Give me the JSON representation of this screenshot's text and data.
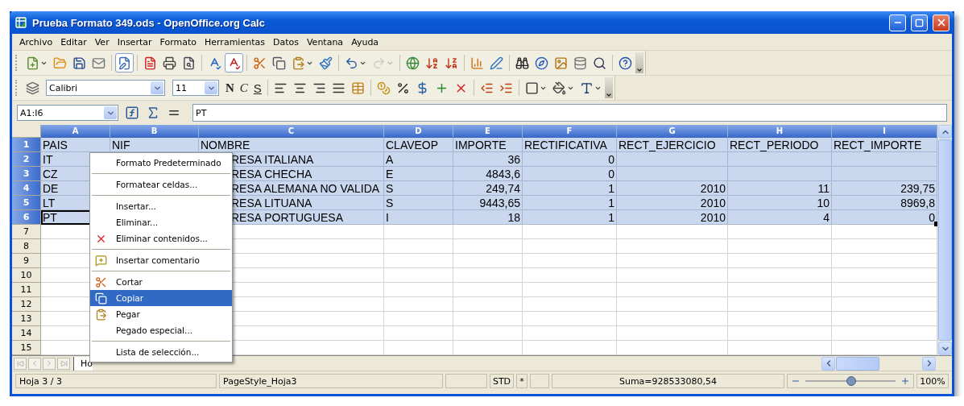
{
  "window": {
    "title": "Prueba Formato 349.ods - OpenOffice.org Calc"
  },
  "menu": [
    "Archivo",
    "Editar",
    "Ver",
    "Insertar",
    "Formato",
    "Herramientas",
    "Datos",
    "Ventana",
    "Ayuda"
  ],
  "toolbar_standard": [
    {
      "kind": "new",
      "dropdown": true
    },
    {
      "kind": "open"
    },
    {
      "kind": "save"
    },
    {
      "kind": "email"
    },
    {
      "kind": "separator"
    },
    {
      "kind": "edit",
      "pressed": true
    },
    {
      "kind": "separator"
    },
    {
      "kind": "pdf"
    },
    {
      "kind": "print"
    },
    {
      "kind": "preview"
    },
    {
      "kind": "separator"
    },
    {
      "kind": "spellcheck"
    },
    {
      "kind": "autospell",
      "pressed": true
    },
    {
      "kind": "separator"
    },
    {
      "kind": "cut"
    },
    {
      "kind": "copy"
    },
    {
      "kind": "paste",
      "dropdown": true
    },
    {
      "kind": "brush"
    },
    {
      "kind": "separator"
    },
    {
      "kind": "undo",
      "dropdown": true
    },
    {
      "kind": "redo",
      "dropdown": true,
      "disabled": true
    },
    {
      "kind": "separator"
    },
    {
      "kind": "navigator"
    },
    {
      "kind": "sort_asc"
    },
    {
      "kind": "sort_desc"
    },
    {
      "kind": "separator"
    },
    {
      "kind": "chart"
    },
    {
      "kind": "draw"
    },
    {
      "kind": "separator"
    },
    {
      "kind": "find"
    },
    {
      "kind": "compass"
    },
    {
      "kind": "gallery"
    },
    {
      "kind": "database"
    },
    {
      "kind": "zoom"
    },
    {
      "kind": "separator"
    },
    {
      "kind": "help"
    }
  ],
  "toolbar_format": [
    {
      "kind": "styles"
    },
    {
      "kind": "font_name",
      "value": "Calibri"
    },
    {
      "kind": "font_size",
      "value": "11"
    },
    {
      "kind": "bold",
      "label": "N"
    },
    {
      "kind": "italic",
      "label": "C"
    },
    {
      "kind": "underline",
      "label": "S"
    },
    {
      "kind": "separator"
    },
    {
      "kind": "align_left"
    },
    {
      "kind": "align_center"
    },
    {
      "kind": "align_right"
    },
    {
      "kind": "justify"
    },
    {
      "kind": "merge"
    },
    {
      "kind": "separator"
    },
    {
      "kind": "currency"
    },
    {
      "kind": "percent"
    },
    {
      "kind": "standard_format"
    },
    {
      "kind": "add_decimal"
    },
    {
      "kind": "delete_decimal"
    },
    {
      "kind": "separator"
    },
    {
      "kind": "indent_decrease"
    },
    {
      "kind": "indent_increase"
    },
    {
      "kind": "separator"
    },
    {
      "kind": "borders",
      "dropdown": true
    },
    {
      "kind": "background",
      "dropdown": true
    },
    {
      "kind": "font_color",
      "dropdown": true
    }
  ],
  "formula_bar": {
    "cell_reference": "A1:I6",
    "content": "PT"
  },
  "sheet": {
    "columns": [
      {
        "label": "A",
        "selected": true
      },
      {
        "label": "B",
        "selected": true
      },
      {
        "label": "C",
        "selected": true
      },
      {
        "label": "D",
        "selected": true
      },
      {
        "label": "E",
        "selected": true
      },
      {
        "label": "F",
        "selected": true
      },
      {
        "label": "G",
        "selected": true
      },
      {
        "label": "H",
        "selected": true
      },
      {
        "label": "I",
        "selected": true
      }
    ],
    "rows": [
      {
        "number": "1",
        "selected": true,
        "cells": [
          "PAIS",
          "NIF",
          "NOMBRE",
          "CLAVEOP",
          "IMPORTE",
          "RECTIFICATIVA",
          "RECT_EJERCICIO",
          "RECT_PERIODO",
          "RECT_IMPORTE"
        ]
      },
      {
        "number": "2",
        "selected": true,
        "cells": [
          "IT",
          null,
          "RESA ITALIANA",
          "A",
          "36",
          "0",
          null,
          null,
          null
        ]
      },
      {
        "number": "3",
        "selected": true,
        "cells": [
          "CZ",
          null,
          "RESA CHECHA",
          "E",
          "4843,6",
          "0",
          null,
          null,
          null
        ]
      },
      {
        "number": "4",
        "selected": true,
        "cells": [
          "DE",
          null,
          "RESA ALEMANA NO VALIDA",
          "S",
          "249,74",
          "1",
          "2010",
          "11",
          "239,75"
        ]
      },
      {
        "number": "5",
        "selected": true,
        "cells": [
          "LT",
          null,
          "RESA LITUANA",
          "S",
          "9443,65",
          "1",
          "2010",
          "10",
          "8969,8"
        ]
      },
      {
        "number": "6",
        "selected": true,
        "cursor": true,
        "cells": [
          "PT",
          null,
          "RESA PORTUGUESA",
          "I",
          "18",
          "1",
          "2010",
          "4",
          "0"
        ]
      },
      {
        "number": "7",
        "selected": false,
        "cells": []
      },
      {
        "number": "8",
        "selected": false,
        "cells": []
      },
      {
        "number": "9",
        "selected": false,
        "cells": []
      },
      {
        "number": "10",
        "selected": false,
        "cells": []
      },
      {
        "number": "11",
        "selected": false,
        "cells": []
      },
      {
        "number": "12",
        "selected": false,
        "cells": []
      },
      {
        "number": "13",
        "selected": false,
        "cells": []
      },
      {
        "number": "14",
        "selected": false,
        "cells": []
      },
      {
        "number": "15",
        "selected": false,
        "cells": []
      }
    ],
    "tabs": [
      {
        "label": "Ho",
        "selected": true
      }
    ]
  },
  "context_menu": [
    {
      "kind": "plain",
      "label": "Formato Predeterminado",
      "selected": false
    },
    {
      "kind": "separator"
    },
    {
      "kind": "plain",
      "label": "Formatear celdas...",
      "selected": false
    },
    {
      "kind": "separator"
    },
    {
      "kind": "plain",
      "label": "Insertar...",
      "selected": false
    },
    {
      "kind": "plain",
      "label": "Eliminar...",
      "selected": false
    },
    {
      "kind": "delete",
      "label": "Eliminar contenidos...",
      "selected": false
    },
    {
      "kind": "separator"
    },
    {
      "kind": "comment",
      "label": "Insertar comentario",
      "selected": false
    },
    {
      "kind": "separator"
    },
    {
      "kind": "cut",
      "label": "Cortar",
      "selected": false
    },
    {
      "kind": "copy",
      "label": "Copiar",
      "selected": true
    },
    {
      "kind": "paste",
      "label": "Pegar",
      "selected": false
    },
    {
      "kind": "plain",
      "label": "Pegado especial...",
      "selected": false
    },
    {
      "kind": "separator"
    },
    {
      "kind": "plain",
      "label": "Lista de selección...",
      "selected": false
    }
  ],
  "status_bar": {
    "sheet": "Hoja 3 / 3",
    "page_style": "PageStyle_Hoja3",
    "mode": "STD",
    "modified": "*",
    "sum": "Suma=928533080,54",
    "zoom": {
      "level": 0.5,
      "reading": "100%"
    }
  }
}
